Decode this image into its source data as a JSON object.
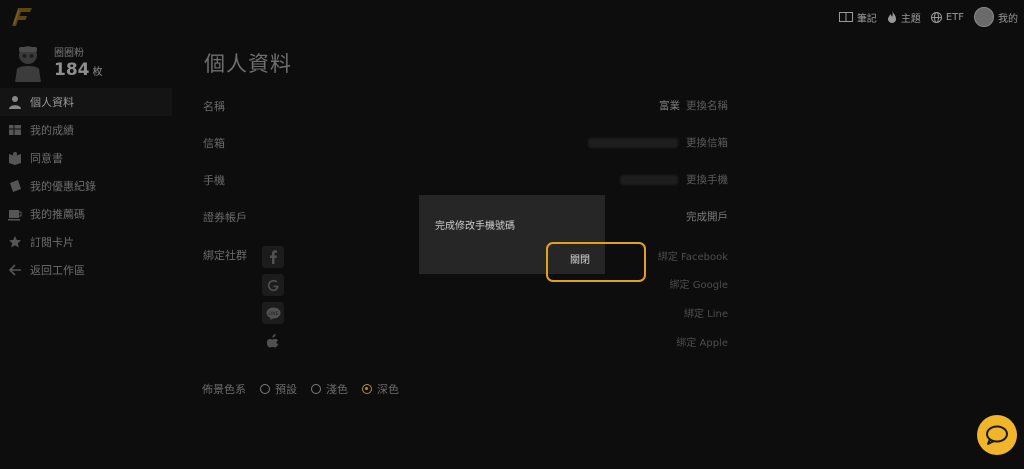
{
  "topnav": {
    "notes": "筆記",
    "theme": "主題",
    "etf": "ETF",
    "mine": "我的"
  },
  "profile": {
    "name": "圈圈粉",
    "count": "184",
    "count_unit": "枚"
  },
  "menu": [
    {
      "label": "個人資料",
      "icon": "user-icon",
      "active": true
    },
    {
      "label": "我的成績",
      "icon": "grid-icon"
    },
    {
      "label": "同意書",
      "icon": "book-icon"
    },
    {
      "label": "我的優惠紀錄",
      "icon": "ticket-icon"
    },
    {
      "label": "我的推薦碼",
      "icon": "cup-icon"
    },
    {
      "label": "訂閱卡片",
      "icon": "star-icon"
    },
    {
      "label": "返回工作區",
      "icon": "arrow-left-icon"
    }
  ],
  "main": {
    "title": "個人資料",
    "rows": {
      "name_label": "名稱",
      "name_value": "富業",
      "name_action": "更換名稱",
      "email_label": "信箱",
      "email_action": "更換信箱",
      "phone_label": "手機",
      "phone_action": "更換手機",
      "broker_label": "證券帳戶",
      "broker_action": "完成開戶",
      "social_label": "綁定社群"
    },
    "social": [
      {
        "icon": "facebook-icon",
        "action": "綁定 Facebook"
      },
      {
        "icon": "google-icon",
        "action": "綁定 Google"
      },
      {
        "icon": "line-icon",
        "action": "綁定 Line"
      },
      {
        "icon": "apple-icon",
        "action": "綁定 Apple"
      }
    ],
    "theme": {
      "label": "佈景色系",
      "options": [
        "預設",
        "淺色",
        "深色"
      ],
      "selected": "深色"
    }
  },
  "dialog": {
    "message": "完成修改手機號碼",
    "close_label": "關閉"
  },
  "colors": {
    "accent": "#e0a21a",
    "chat_button": "#f0b52a"
  }
}
